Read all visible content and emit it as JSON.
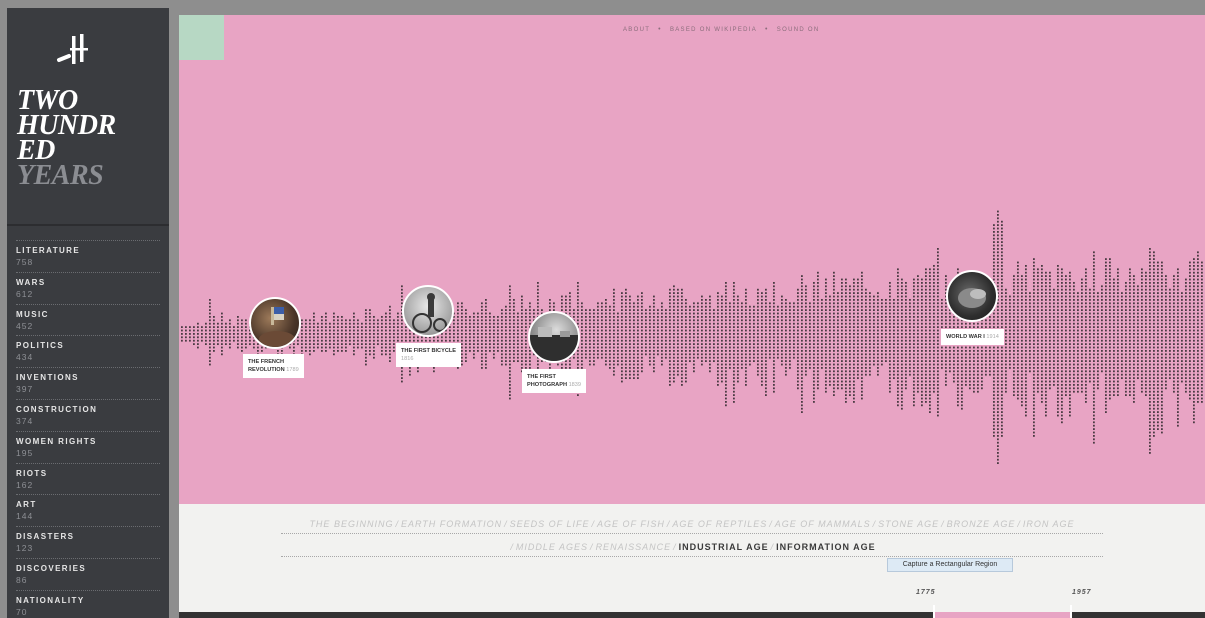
{
  "sidebar": {
    "logo_icon": "dagger-mark-icon",
    "title_lines": [
      "TWO",
      "HUNDR",
      "ED"
    ],
    "title_dim_line": "YEARS",
    "categories": [
      {
        "label": "LITERATURE",
        "count": "758"
      },
      {
        "label": "WARS",
        "count": "612"
      },
      {
        "label": "MUSIC",
        "count": "452"
      },
      {
        "label": "POLITICS",
        "count": "434"
      },
      {
        "label": "INVENTIONS",
        "count": "397"
      },
      {
        "label": "CONSTRUCTION",
        "count": "374"
      },
      {
        "label": "WOMEN RIGHTS",
        "count": "195"
      },
      {
        "label": "RIOTS",
        "count": "162"
      },
      {
        "label": "ART",
        "count": "144"
      },
      {
        "label": "DISASTERS",
        "count": "123"
      },
      {
        "label": "DISCOVERIES",
        "count": "86"
      },
      {
        "label": "NATIONALITY",
        "count": "70"
      }
    ]
  },
  "nav": {
    "about": "ABOUT",
    "wikipedia": "BASED ON WIKIPEDIA",
    "sound": "SOUND ON",
    "dot": "•"
  },
  "colors": {
    "pink": "#e8a4c4",
    "sidebar": "#3a3c40",
    "mint": "#b7d8c4",
    "dots": "#4a3a42"
  },
  "events": [
    {
      "title": "THE FRENCH",
      "title2": "REVOLUTION",
      "year": "1789"
    },
    {
      "title": "THE FIRST BICYCLE",
      "title2": "",
      "year": "1816"
    },
    {
      "title": "THE FIRST",
      "title2": "PHOTOGRAPH",
      "year": "1839"
    },
    {
      "title": "WORLD WAR I",
      "title2": "",
      "year": "1914"
    }
  ],
  "eras": {
    "line1": [
      "THE BEGINNING",
      "EARTH FORMATION",
      "SEEDS OF LIFE",
      "AGE OF FISH",
      "AGE OF REPTILES",
      "AGE OF MAMMALS",
      "STONE AGE",
      "BRONZE AGE",
      "IRON AGE"
    ],
    "line2": [
      "MIDDLE AGES",
      "RENAISSANCE",
      "INDUSTRIAL AGE",
      "INFORMATION AGE"
    ],
    "separator": "/"
  },
  "timeline": {
    "start_year": "1775",
    "end_year": "1957"
  },
  "tooltip": "Capture a Rectangular Region"
}
